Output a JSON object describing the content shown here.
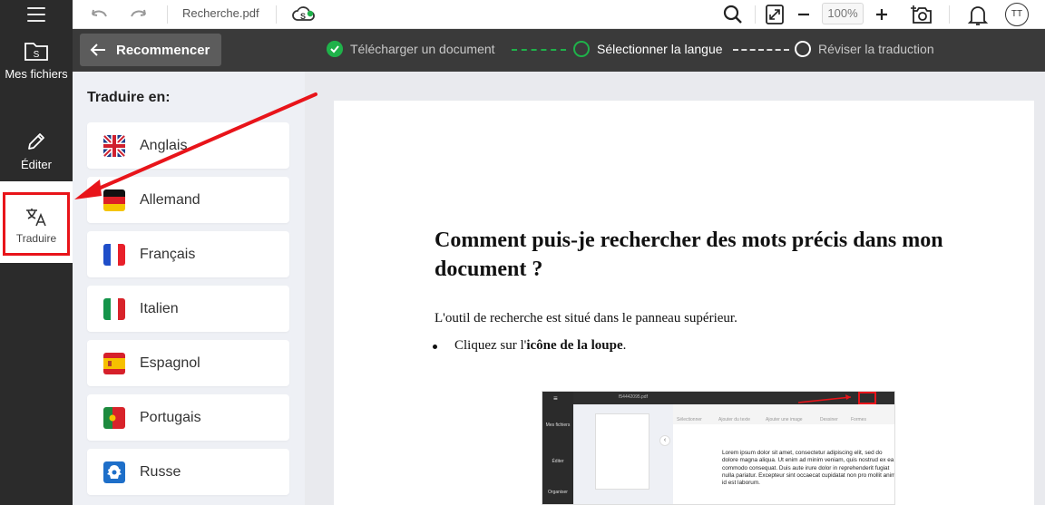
{
  "app": {
    "file_name": "Recherche.pdf",
    "zoom": "100%",
    "avatar_initials": "TT"
  },
  "sidebar": {
    "items": [
      {
        "label": "Mes fichiers",
        "icon": "folder-icon"
      },
      {
        "label": "Éditer",
        "icon": "pencil-icon"
      },
      {
        "label": "Traduire",
        "icon": "translate-icon",
        "active": true
      }
    ]
  },
  "steps": {
    "restart_label": "Recommencer",
    "items": [
      {
        "label": "Télécharger un document",
        "state": "done"
      },
      {
        "label": "Sélectionner la langue",
        "state": "current"
      },
      {
        "label": "Réviser la traduction",
        "state": "pending"
      }
    ]
  },
  "translate_panel": {
    "title": "Traduire en:",
    "languages": [
      {
        "label": "Anglais",
        "flag": "uk-flag-icon"
      },
      {
        "label": "Allemand",
        "flag": "germany-flag-icon"
      },
      {
        "label": "Français",
        "flag": "france-flag-icon"
      },
      {
        "label": "Italien",
        "flag": "italy-flag-icon"
      },
      {
        "label": "Espagnol",
        "flag": "spain-flag-icon"
      },
      {
        "label": "Portugais",
        "flag": "portugal-flag-icon"
      },
      {
        "label": "Russe",
        "flag": "russia-flag-icon"
      }
    ]
  },
  "document": {
    "heading": "Comment puis-je rechercher des mots précis dans mon document ?",
    "paragraph": "L'outil de recherche est situé dans le panneau supérieur.",
    "bullet_prefix": "Cliquez sur l'",
    "bullet_bold": "icône de la loupe",
    "bullet_suffix": ".",
    "screenshot": {
      "file": "f54442095.pdf",
      "rail": [
        "Mes fichiers",
        "Éditer",
        "Organiser"
      ],
      "tools": [
        "Sélectionner",
        "Ajouter du texte",
        "Ajouter une image",
        "Dessiner",
        "Formes"
      ],
      "lorem": "Lorem ipsum dolor sit amet, consectetur adipiscing elit, sed do dolore magna aliqua. Ut enim ad minim veniam, quis nostrud ex ea commodo consequat. Duis aute irure dolor in reprehenderit fugiat nulla pariatur. Excepteur sint occaecat cupidatat non pro mollit anim id est laborum."
    }
  },
  "colors": {
    "accent_green": "#1fb24a",
    "highlight_red": "#e8141a",
    "dark": "#2b2b2b"
  }
}
